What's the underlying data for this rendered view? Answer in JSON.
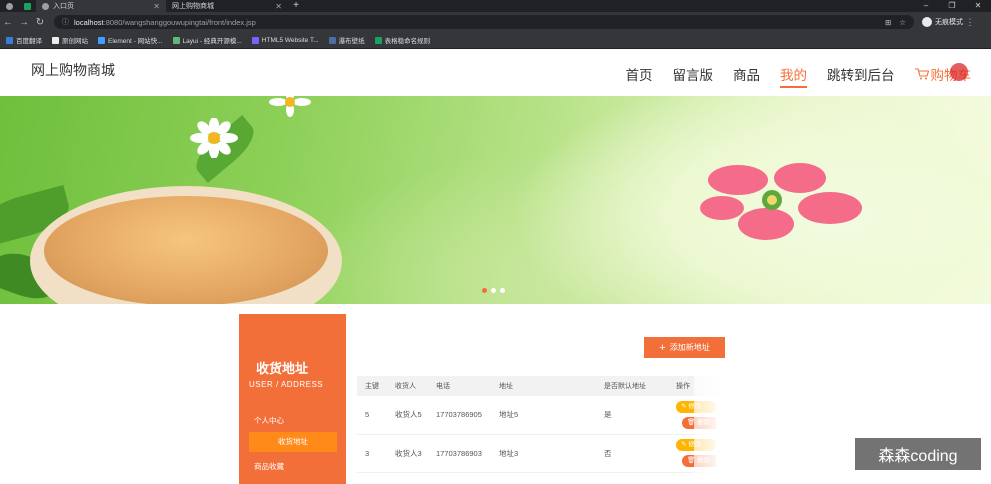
{
  "browser": {
    "tabs": [
      {
        "label": "入口页"
      },
      {
        "label": "网上购物商城"
      }
    ],
    "url_host": "localhost",
    "url_path": ":8080/wangshanggouwupingtai/front/index.jsp",
    "incognito_label": "无痕模式",
    "bookmarks": [
      {
        "label": "百度翻译",
        "color": "#3b7ddd"
      },
      {
        "label": "原创网站",
        "color": "#222222"
      },
      {
        "label": "Element - 网站快...",
        "color": "#409eff"
      },
      {
        "label": "Layui - 经典开源模...",
        "color": "#5fb878"
      },
      {
        "label": "HTML5 Website T...",
        "color": "#7b61ff"
      },
      {
        "label": "瀑布壁纸",
        "color": "#4a6fa5"
      },
      {
        "label": "表格稳命名规则",
        "color": "#1aa15f"
      }
    ]
  },
  "site": {
    "title": "网上购物商城",
    "nav": [
      {
        "label": "首页"
      },
      {
        "label": "留言版"
      },
      {
        "label": "商品"
      },
      {
        "label": "我的"
      },
      {
        "label": "跳转到后台"
      },
      {
        "label": "购物车"
      }
    ],
    "active_nav": "我的",
    "accent_color": "#f36f39"
  },
  "banner": {
    "slides": 3,
    "active_slide": 1
  },
  "sidebar": {
    "title": "收货地址",
    "subtitle": "USER / ADDRESS",
    "items": [
      {
        "label": "个人中心"
      },
      {
        "label": "收货地址"
      },
      {
        "label": "商品收藏"
      }
    ]
  },
  "main": {
    "add_button": "添加新地址",
    "table": {
      "headers": [
        "主键",
        "收货人",
        "电话",
        "地址",
        "是否默认地址",
        "操作"
      ],
      "rows": [
        {
          "id": "5",
          "name": "收货人5",
          "phone": "17703786905",
          "address": "地址5",
          "default": "是",
          "edit": "修改",
          "delete": "删除"
        },
        {
          "id": "3",
          "name": "收货人3",
          "phone": "17703786903",
          "address": "地址3",
          "default": "否",
          "edit": "修改",
          "delete": "删除"
        }
      ]
    }
  },
  "watermark": "森森coding"
}
